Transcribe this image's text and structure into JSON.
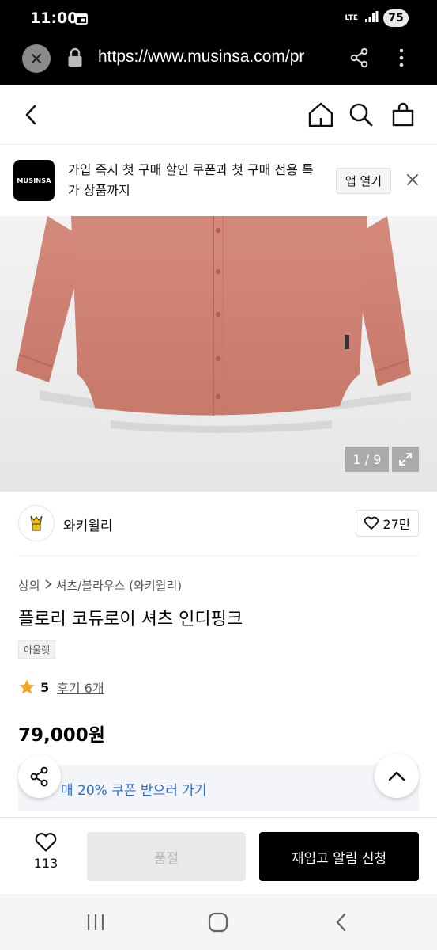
{
  "status_bar": {
    "time": "11:00",
    "network": "LTE",
    "battery": "75"
  },
  "browser": {
    "url": "https://www.musinsa.com/pr"
  },
  "promo": {
    "logo_text": "MUSINSA",
    "message": "가입 즉시 첫 구매 할인 쿠폰과 첫 구매 전용 특가 상품까지",
    "open_label": "앱 열기"
  },
  "image": {
    "counter": "1 / 9"
  },
  "brand": {
    "name": "와키윌리",
    "likes": "27만"
  },
  "product": {
    "breadcrumb_category": "상의",
    "breadcrumb_sub": "셔츠/블라우스 (와키윌리)",
    "title": "플로리 코듀로이 셔츠 인디핑크",
    "badge": "아울렛",
    "rating": "5",
    "reviews": "후기 6개",
    "price": "79,000원",
    "coupon": "매 20% 쿠폰 받으러 가기"
  },
  "actions": {
    "wish_count": "113",
    "soldout_label": "품절",
    "restock_label": "재입고 알림 신청"
  },
  "colors": {
    "accent_blue": "#2d6fd6",
    "shirt": "#d08576",
    "star": "#f5a623"
  }
}
